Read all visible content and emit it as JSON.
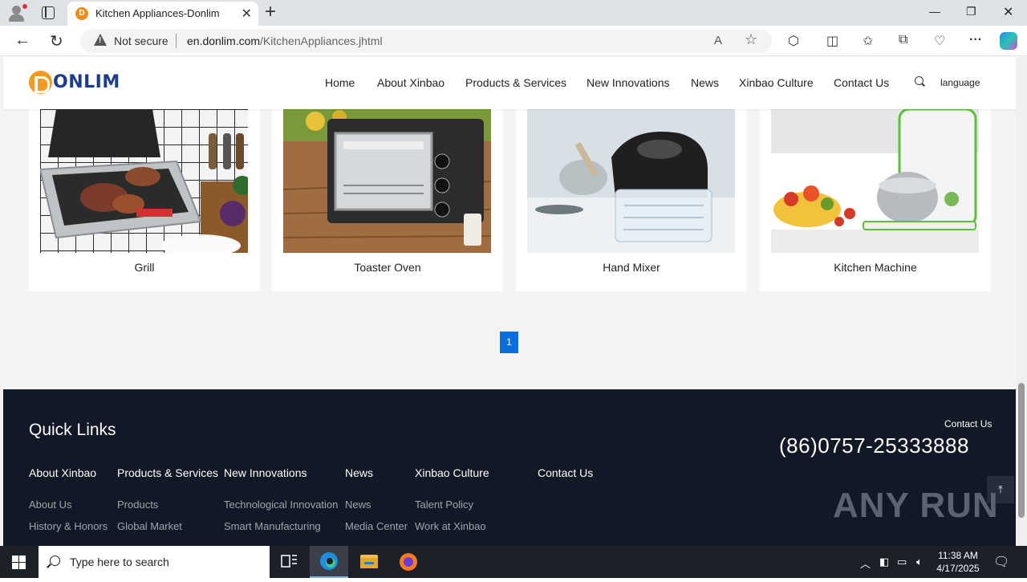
{
  "browser": {
    "tab_title": "Kitchen Appliances-Donlim",
    "tab_favicon_letter": "D",
    "security_label": "Not secure",
    "url_host": "en.donlim.com",
    "url_path": "/KitchenAppliances.jhtml"
  },
  "site": {
    "logo_text": "DONLIM",
    "nav": [
      "Home",
      "About Xinbao",
      "Products & Services",
      "New Innovations",
      "News",
      "Xinbao Culture",
      "Contact Us"
    ],
    "language_label": "language"
  },
  "products": [
    {
      "name": "Grill"
    },
    {
      "name": "Toaster Oven"
    },
    {
      "name": "Hand Mixer"
    },
    {
      "name": "Kitchen Machine"
    }
  ],
  "pagination": {
    "current": "1"
  },
  "footer": {
    "quick_links_title": "Quick Links",
    "contact_label": "Contact Us",
    "phone": "(86)0757-25333888",
    "columns": [
      {
        "heading": "About Xinbao",
        "links": [
          "About Us",
          "History & Honors"
        ]
      },
      {
        "heading": "Products & Services",
        "links": [
          "Products",
          "Global Market"
        ]
      },
      {
        "heading": "New Innovations",
        "links": [
          "Technological Innovation",
          "Smart Manufacturing"
        ]
      },
      {
        "heading": "News",
        "links": [
          "News",
          "Media Center"
        ]
      },
      {
        "heading": "Xinbao Culture",
        "links": [
          "Talent Policy",
          "Work at Xinbao"
        ]
      },
      {
        "heading": "Contact Us",
        "links": []
      }
    ],
    "watermark": "ANY RUN"
  },
  "taskbar": {
    "search_placeholder": "Type here to search",
    "time": "11:38 AM",
    "date": "4/17/2025"
  }
}
